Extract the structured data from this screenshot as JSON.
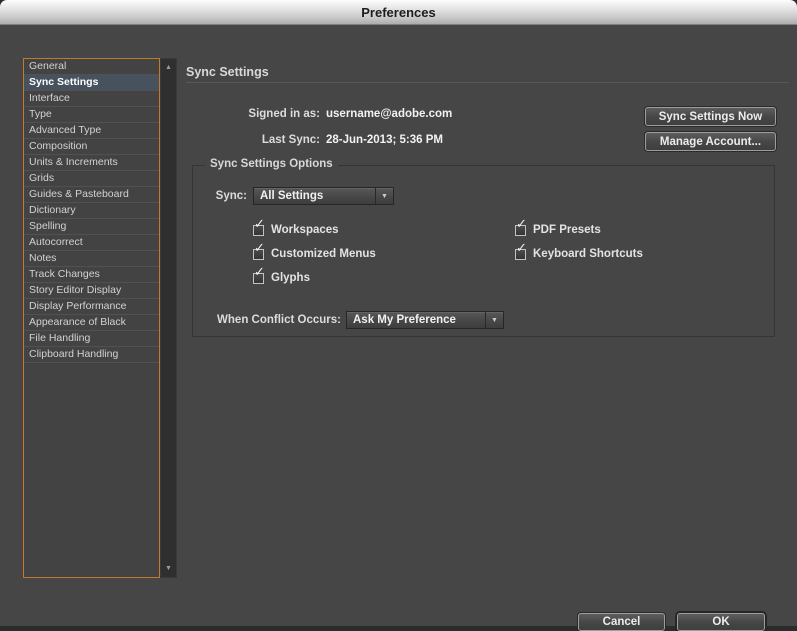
{
  "window": {
    "title": "Preferences"
  },
  "colors": {
    "accent_orange_border": "#c1792e",
    "selection_blue_gray": "#46525d",
    "content_background": "#464646",
    "titlebar_gradient_top": "#fdfdfd",
    "titlebar_gradient_bottom": "#adadad"
  },
  "icons": {
    "checkmark": "✓",
    "dropdown_arrow": "▼",
    "scroll_up_arrow": "▲",
    "scroll_down_arrow": "▼"
  },
  "sidebar": {
    "items": [
      {
        "label": "General",
        "selected": false
      },
      {
        "label": "Sync Settings",
        "selected": true
      },
      {
        "label": "Interface",
        "selected": false
      },
      {
        "label": "Type",
        "selected": false
      },
      {
        "label": "Advanced Type",
        "selected": false
      },
      {
        "label": "Composition",
        "selected": false
      },
      {
        "label": "Units & Increments",
        "selected": false
      },
      {
        "label": "Grids",
        "selected": false
      },
      {
        "label": "Guides & Pasteboard",
        "selected": false
      },
      {
        "label": "Dictionary",
        "selected": false
      },
      {
        "label": "Spelling",
        "selected": false
      },
      {
        "label": "Autocorrect",
        "selected": false
      },
      {
        "label": "Notes",
        "selected": false
      },
      {
        "label": "Track Changes",
        "selected": false
      },
      {
        "label": "Story Editor Display",
        "selected": false
      },
      {
        "label": "Display Performance",
        "selected": false
      },
      {
        "label": "Appearance of Black",
        "selected": false
      },
      {
        "label": "File Handling",
        "selected": false
      },
      {
        "label": "Clipboard Handling",
        "selected": false
      }
    ]
  },
  "panel": {
    "title": "Sync Settings",
    "account": {
      "signed_in_label": "Signed in as:",
      "signed_in_value": "username@adobe.com",
      "last_sync_label": "Last Sync:",
      "last_sync_value": "28-Jun-2013; 5:36 PM"
    },
    "buttons": {
      "sync_now": "Sync Settings Now",
      "manage_account": "Manage Account..."
    },
    "options_group": {
      "legend": "Sync Settings Options",
      "sync_label": "Sync:",
      "sync_value": "All Settings",
      "checkboxes_left": [
        {
          "label": "Workspaces",
          "checked": true
        },
        {
          "label": "Customized Menus",
          "checked": true
        },
        {
          "label": "Glyphs",
          "checked": true
        }
      ],
      "checkboxes_right": [
        {
          "label": "PDF Presets",
          "checked": true
        },
        {
          "label": "Keyboard Shortcuts",
          "checked": true
        }
      ],
      "conflict_label": "When Conflict Occurs:",
      "conflict_value": "Ask My Preference"
    },
    "footer": {
      "cancel": "Cancel",
      "ok": "OK"
    }
  }
}
